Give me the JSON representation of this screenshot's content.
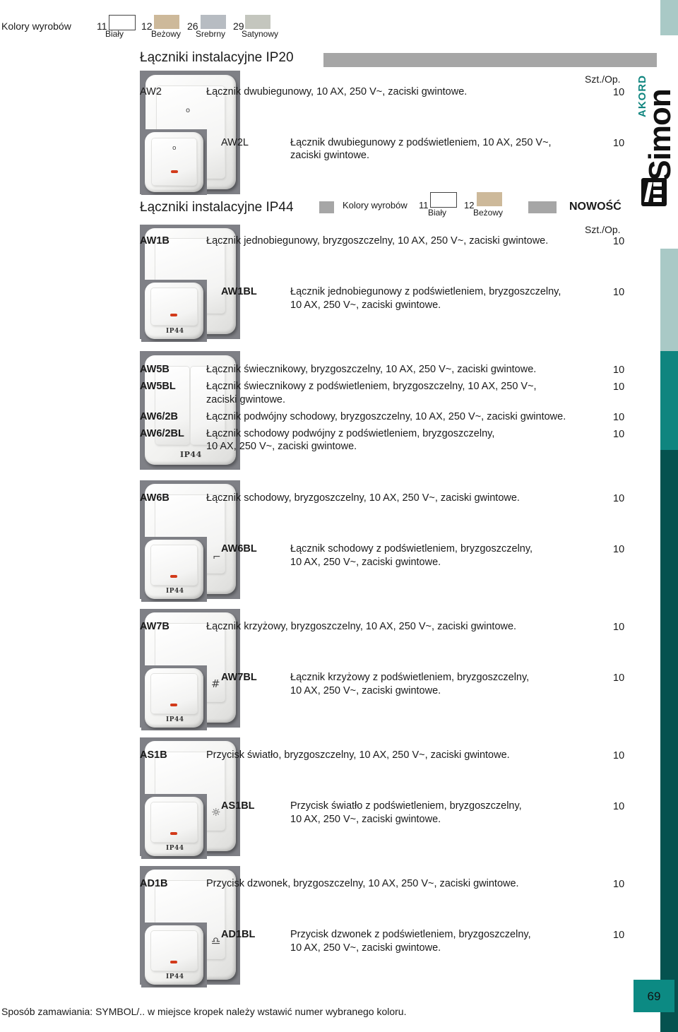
{
  "colors_top": {
    "label": "Kolory wyrobów",
    "items": [
      {
        "code": "11",
        "name": "Biały",
        "color": "#ffffff"
      },
      {
        "code": "12",
        "name": "Beżowy",
        "color": "#cdb99a"
      },
      {
        "code": "26",
        "name": "Srebrny",
        "color": "#b7bcc2"
      },
      {
        "code": "29",
        "name": "Satynowy",
        "color": "#c4c6be"
      }
    ]
  },
  "section_ip20": {
    "title": "Łączniki instalacyjne IP20",
    "qty_header": "Szt./Op."
  },
  "section_ip44": {
    "title": "Łączniki instalacyjne IP44",
    "colors_label": "Kolory wyrobów",
    "colors": [
      {
        "code": "11",
        "name": "Biały",
        "color": "#ffffff"
      },
      {
        "code": "12",
        "name": "Beżowy",
        "color": "#cdb99a"
      }
    ],
    "badge": "NOWOŚĆ",
    "qty_header": "Szt./Op."
  },
  "products": [
    {
      "code": "AW2",
      "desc": "Łącznik dwubiegunowy, 10 AX, 250 V~, zaciski gwintowe.",
      "qty": "10"
    },
    {
      "code": "AW2L",
      "desc": "Łącznik dwubiegunowy z podświetleniem, 10 AX, 250 V~,",
      "desc2": "zaciski gwintowe.",
      "qty": "10"
    },
    {
      "code": "AW1B",
      "desc": "Łącznik jednobiegunowy, bryzgoszczelny, 10 AX, 250 V~, zaciski gwintowe.",
      "qty": "10"
    },
    {
      "code": "AW1BL",
      "desc": "Łącznik jednobiegunowy z podświetleniem, bryzgoszczelny,",
      "desc2": "10 AX, 250 V~, zaciski gwintowe.",
      "qty": "10"
    },
    {
      "code": "AW5B",
      "desc": "Łącznik świecznikowy, bryzgoszczelny, 10 AX, 250 V~, zaciski gwintowe.",
      "qty": "10"
    },
    {
      "code": "AW5BL",
      "desc": "Łącznik świecznikowy z podświetleniem, bryzgoszczelny, 10 AX, 250 V~,",
      "desc2": "zaciski gwintowe.",
      "qty": "10"
    },
    {
      "code": "AW6/2B",
      "desc": "Łącznik podwójny schodowy, bryzgoszczelny, 10 AX, 250 V~, zaciski gwintowe.",
      "qty": "10"
    },
    {
      "code": "AW6/2BL",
      "desc": "Łącznik schodowy podwójny z podświetleniem, bryzgoszczelny,",
      "desc2": "10 AX, 250 V~, zaciski gwintowe.",
      "qty": "10"
    },
    {
      "code": "AW6B",
      "desc": "Łącznik schodowy, bryzgoszczelny, 10 AX, 250 V~, zaciski gwintowe.",
      "qty": "10"
    },
    {
      "code": "AW6BL",
      "desc": "Łącznik schodowy z podświetleniem, bryzgoszczelny,",
      "desc2": "10 AX, 250 V~, zaciski gwintowe.",
      "qty": "10"
    },
    {
      "code": "AW7B",
      "desc": "Łącznik krzyżowy, bryzgoszczelny, 10 AX, 250 V~, zaciski gwintowe.",
      "qty": "10"
    },
    {
      "code": "AW7BL",
      "desc": "Łącznik krzyżowy z podświetleniem, bryzgoszczelny,",
      "desc2": "10 AX, 250 V~, zaciski gwintowe.",
      "qty": "10"
    },
    {
      "code": "AS1B",
      "desc": "Przycisk światło, bryzgoszczelny, 10 AX, 250 V~, zaciski gwintowe.",
      "qty": "10"
    },
    {
      "code": "AS1BL",
      "desc": "Przycisk światło z podświetleniem, bryzgoszczelny,",
      "desc2": "10 AX, 250 V~, zaciski gwintowe.",
      "qty": "10"
    },
    {
      "code": "AD1B",
      "desc": "Przycisk dzwonek, bryzgoszczelny, 10 AX, 250 V~, zaciski gwintowe.",
      "qty": "10"
    },
    {
      "code": "AD1BL",
      "desc": "Przycisk dzwonek z podświetleniem, bryzgoszczelny,",
      "desc2": "10 AX, 250 V~, zaciski gwintowe.",
      "qty": "10"
    }
  ],
  "photo_label": "IP44",
  "brand": {
    "name": "Simon",
    "series": "AKORD"
  },
  "footer": {
    "note": "Sposób zamawiania: SYMBOL/.. w miejsce kropek należy wstawić numer wybranego koloru.",
    "page_number": "69"
  },
  "palette": {
    "teal_dark": "#05524f",
    "teal": "#0f857f",
    "teal_light": "#9fc4c1",
    "page_box": "#0c8a83"
  }
}
